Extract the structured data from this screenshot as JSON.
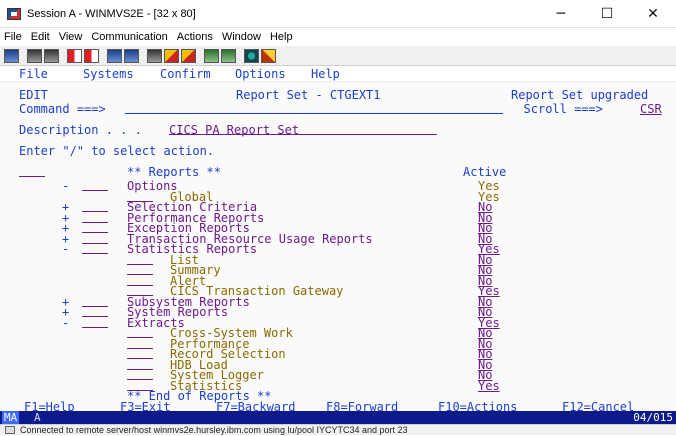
{
  "window": {
    "title": "Session A - WINMVS2E - [32 x 80]",
    "minimize": "─",
    "maximize": "☐",
    "close": "✕"
  },
  "menu": [
    "File",
    "Edit",
    "View",
    "Communication",
    "Actions",
    "Window",
    "Help"
  ],
  "toolbar_icons": [
    "print-icon",
    "copy-icon",
    "paste-icon",
    "send-icon",
    "receive-icon",
    "display-icon",
    "mail-icon",
    "macro-play-icon",
    "macro-record-icon",
    "stop-icon",
    "macro-icon",
    "help-icon",
    "customize-icon"
  ],
  "terminal": {
    "action_bar": [
      "File",
      "Systems",
      "Confirm",
      "Options",
      "Help"
    ],
    "mode": "EDIT",
    "panel_title": "Report Set - CTGEXT1",
    "status_msg": "Report Set upgraded",
    "command_label": "Command ===>",
    "command_value": "",
    "scroll_label": "Scroll ===>",
    "scroll_value": "CSR",
    "description_label": "Description . . .",
    "description_value": "CICS PA Report Set",
    "instruction": "Enter \"/\" to select action.",
    "reports_header": "** Reports **",
    "active_header": "Active",
    "end_line": "** End of Reports **",
    "rows": [
      {
        "expand": "-",
        "label": "Options",
        "indent": 0,
        "active": "Yes",
        "active_field": false
      },
      {
        "expand": "",
        "label": "Global",
        "indent": 2,
        "active": "Yes",
        "active_field": false
      },
      {
        "expand": "+",
        "label": "Selection Criteria",
        "indent": 0,
        "active": "No",
        "active_field": true
      },
      {
        "expand": "+",
        "label": "Performance Reports",
        "indent": 0,
        "active": "No",
        "active_field": true
      },
      {
        "expand": "+",
        "label": "Exception Reports",
        "indent": 0,
        "active": "No",
        "active_field": true
      },
      {
        "expand": "+",
        "label": "Transaction Resource Usage Reports",
        "indent": 0,
        "active": "No",
        "active_field": true
      },
      {
        "expand": "-",
        "label": "Statistics Reports",
        "indent": 0,
        "active": "Yes",
        "active_field": true
      },
      {
        "expand": "",
        "label": "List",
        "indent": 2,
        "active": "No",
        "active_field": true
      },
      {
        "expand": "",
        "label": "Summary",
        "indent": 2,
        "active": "No",
        "active_field": true
      },
      {
        "expand": "",
        "label": "Alert",
        "indent": 2,
        "active": "No",
        "active_field": true
      },
      {
        "expand": "",
        "label": "CICS Transaction Gateway",
        "indent": 2,
        "active": "Yes",
        "active_field": true
      },
      {
        "expand": "+",
        "label": "Subsystem Reports",
        "indent": 0,
        "active": "No",
        "active_field": true
      },
      {
        "expand": "+",
        "label": "System Reports",
        "indent": 0,
        "active": "No",
        "active_field": true
      },
      {
        "expand": "-",
        "label": "Extracts",
        "indent": 0,
        "active": "Yes",
        "active_field": true
      },
      {
        "expand": "",
        "label": "Cross-System Work",
        "indent": 2,
        "active": "No",
        "active_field": true
      },
      {
        "expand": "",
        "label": "Performance",
        "indent": 2,
        "active": "No",
        "active_field": true
      },
      {
        "expand": "",
        "label": "Record Selection",
        "indent": 2,
        "active": "No",
        "active_field": true
      },
      {
        "expand": "",
        "label": "HDB Load",
        "indent": 2,
        "active": "No",
        "active_field": true
      },
      {
        "expand": "",
        "label": "System Logger",
        "indent": 2,
        "active": "No",
        "active_field": true
      },
      {
        "expand": "",
        "label": "Statistics",
        "indent": 2,
        "active": "Yes",
        "active_field": true
      }
    ],
    "fkeys": [
      "F1=Help",
      "F3=Exit",
      "F7=Backward",
      "F8=Forward",
      "F10=Actions",
      "F12=Cancel"
    ]
  },
  "oia": {
    "indicator": "MA",
    "session": "A",
    "cursor_pos": "04/015"
  },
  "status_bar": "Connected to remote server/host winmvs2e.hursley.ibm.com using lu/pool IYCYTC34 and port 23"
}
